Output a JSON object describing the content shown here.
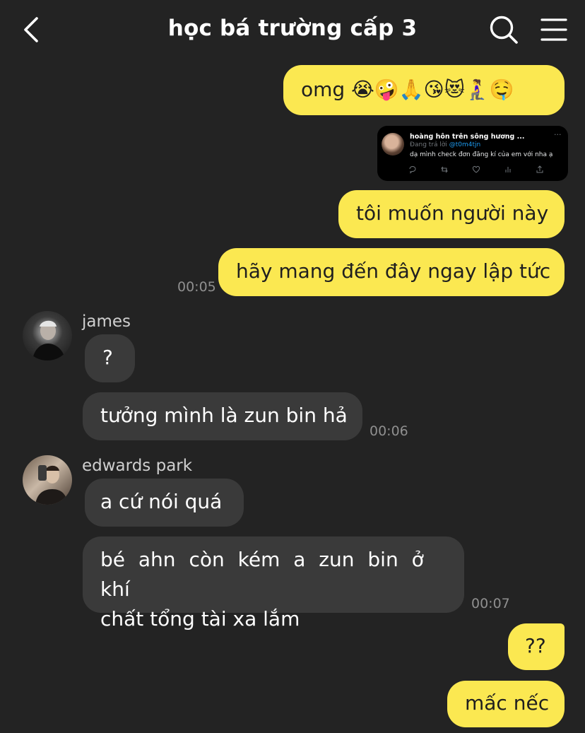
{
  "header": {
    "title": "học bá trường cấp 3"
  },
  "messages": {
    "m1": "omg 😭🤪🙏😘😻🧎‍♀️🤤",
    "m2": "tôi muốn người này",
    "m3": "hãy mang đến đây ngay lập tức",
    "m3_time": "00:05",
    "james_name": "james",
    "j1": "?",
    "j2": "tưởng mình là zun bin hả",
    "j2_time": "00:06",
    "edwards_name": "edwards park",
    "e1": "a cứ nói quá",
    "e2_line1": "bé ahn còn kém a zun bin ở khí",
    "e2_line2": "chất tổng tài xa lắm",
    "e2_time": "00:07",
    "m4": "??",
    "m5": "mấc nếc"
  },
  "tweet": {
    "name": "hoàng hôn trên sông hương ...",
    "more": "···",
    "reply_prefix": "Đang trả lời ",
    "reply_handle": "@t0m4tjn",
    "text": "dạ mình check đơn đăng kí của em với nha ạ"
  },
  "colors": {
    "background": "#232323",
    "my_bubble": "#fbe851",
    "their_bubble": "#3a3a3a"
  },
  "icons": [
    "back-arrow-icon",
    "search-icon",
    "menu-icon",
    "reply-icon",
    "retweet-icon",
    "like-icon",
    "views-icon",
    "share-icon"
  ]
}
